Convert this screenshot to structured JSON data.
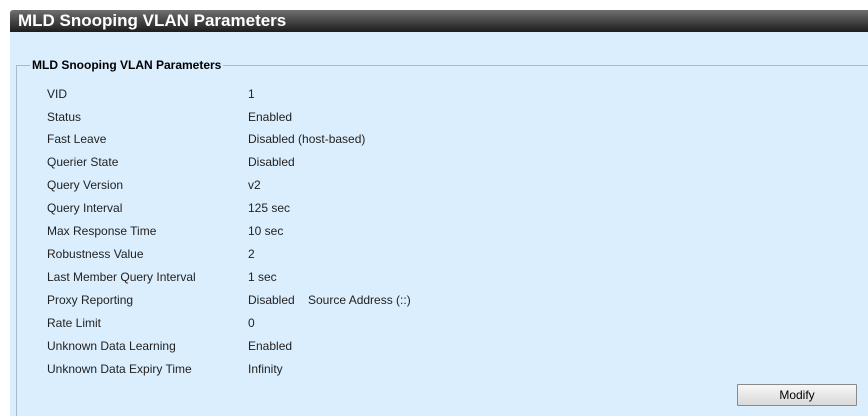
{
  "title": "MLD Snooping VLAN Parameters",
  "legend": "MLD Snooping VLAN Parameters",
  "params": [
    {
      "label": "VID",
      "value": "1"
    },
    {
      "label": "Status",
      "value": "Enabled"
    },
    {
      "label": "Fast Leave",
      "value": "Disabled (host-based)"
    },
    {
      "label": "Querier State",
      "value": "Disabled"
    },
    {
      "label": "Query Version",
      "value": "v2"
    },
    {
      "label": "Query Interval",
      "value": "125 sec"
    },
    {
      "label": "Max Response Time",
      "value": "10 sec"
    },
    {
      "label": "Robustness Value",
      "value": "2"
    },
    {
      "label": "Last Member Query Interval",
      "value": "1 sec"
    },
    {
      "label": "Proxy Reporting",
      "value": "Disabled",
      "value2": "Source Address (::)"
    },
    {
      "label": "Rate Limit",
      "value": "0"
    },
    {
      "label": "Unknown Data Learning",
      "value": "Enabled"
    },
    {
      "label": "Unknown Data Expiry Time",
      "value": "Infinity"
    }
  ],
  "modify_label": "Modify"
}
